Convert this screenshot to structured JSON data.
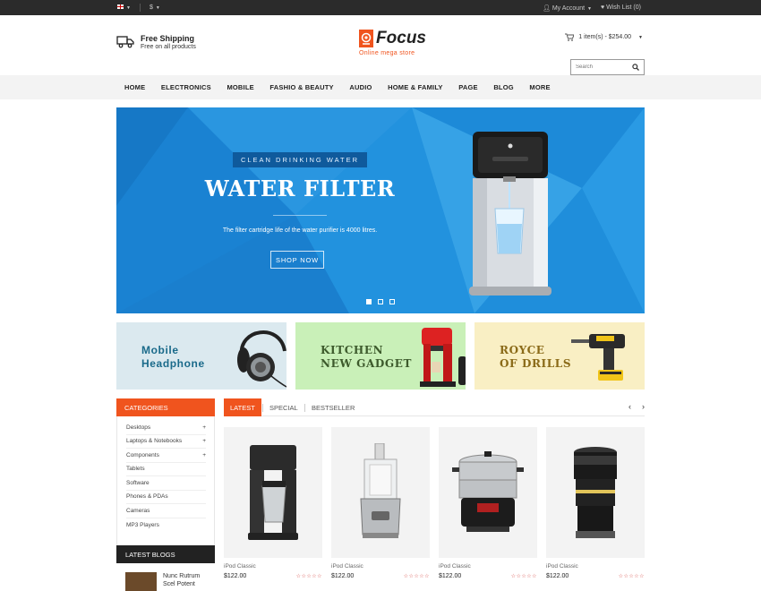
{
  "topbar": {
    "currency": "$",
    "account": "My Account",
    "wishlist": "Wish List (0)"
  },
  "header": {
    "shipping_title": "Free Shipping",
    "shipping_sub": "Free on all products",
    "logo_name": "Focus",
    "logo_tagline": "Online mega store",
    "cart_text": "1 item(s) - $254.00",
    "search_placeholder": "Search"
  },
  "nav": {
    "items": [
      "HOME",
      "ELECTRONICS",
      "MOBILE",
      "FASHIO & BEAUTY",
      "AUDIO",
      "HOME & FAMILY",
      "PAGE",
      "BLOG",
      "MORE"
    ]
  },
  "hero": {
    "tag": "CLEAN DRINKING WATER",
    "title": "WATER FILTER",
    "description": "The filter cartridge life of the water purifier is 4000 litres.",
    "button": "SHOP NOW",
    "slide_count": 3,
    "active_slide": 1
  },
  "banners": [
    {
      "line1": "Mobile",
      "line2": "Headphone"
    },
    {
      "line1": "KITCHEN",
      "line2": "NEW GADGET"
    },
    {
      "line1": "ROYCE",
      "line2": "OF DRILLS"
    }
  ],
  "categories": {
    "heading": "CATEGORIES",
    "items": [
      {
        "label": "Desktops",
        "expand": "+"
      },
      {
        "label": "Laptops & Notebooks",
        "expand": "+"
      },
      {
        "label": "Components",
        "expand": "+"
      },
      {
        "label": "Tablets",
        "expand": ""
      },
      {
        "label": "Software",
        "expand": ""
      },
      {
        "label": "Phones & PDAs",
        "expand": ""
      },
      {
        "label": "Cameras",
        "expand": ""
      },
      {
        "label": "MP3 Players",
        "expand": ""
      }
    ]
  },
  "blogs": {
    "heading": "LATEST BLOGS",
    "first_title_line1": "Nunc Rutrum",
    "first_title_line2": "Scel Potent"
  },
  "product_tabs": {
    "items": [
      "LATEST",
      "SPECIAL",
      "BESTSELLER"
    ],
    "active": "LATEST"
  },
  "products": [
    {
      "name": "iPod Classic",
      "price": "$122.00",
      "rating": 0,
      "icon": "coffee-maker"
    },
    {
      "name": "iPod Classic",
      "price": "$122.00",
      "rating": 0,
      "icon": "food-processor"
    },
    {
      "name": "iPod Classic",
      "price": "$122.00",
      "rating": 0,
      "icon": "steamer-pot"
    },
    {
      "name": "iPod Classic",
      "price": "$122.00",
      "rating": 0,
      "icon": "camera-lens"
    }
  ],
  "colors": {
    "accent": "#f0541e",
    "hero_blue": "#1e8ad8",
    "topbar": "#2b2b2b",
    "nav_bg": "#f3f3f3"
  }
}
